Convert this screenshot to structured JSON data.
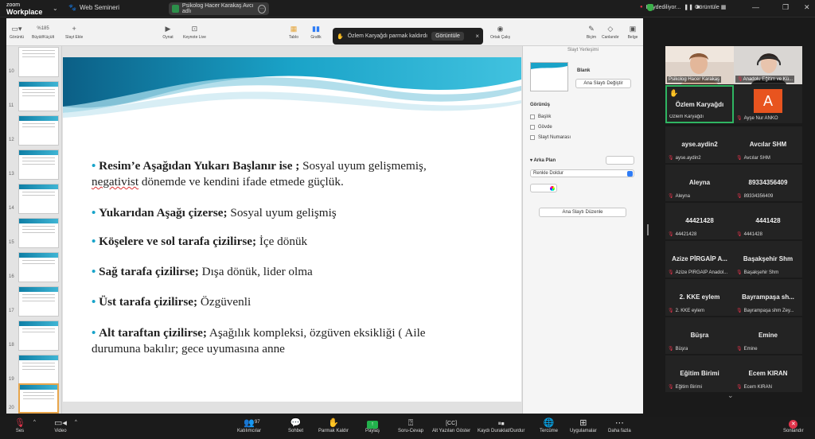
{
  "topbar": {
    "logo_line1": "zoom",
    "logo_line2": "Workplace",
    "webinar_title": "Web Semineri",
    "share_label": "Psikolog Hacer Karakaş Avcı adlı",
    "recording_status": "Kaydediliyor...",
    "view_label": "Görüntüle"
  },
  "keynote": {
    "toolbar": [
      {
        "label": "Görüntü",
        "icon": "sidebar-view-icon"
      },
      {
        "label": "Büyüt/Küçült",
        "icon": "zoom-icon",
        "value": "%185"
      },
      {
        "label": "Slayt Ekle",
        "icon": "plus-icon"
      },
      {
        "label": "Oynat",
        "icon": "play-icon"
      },
      {
        "label": "Keynote Live",
        "icon": "keynote-live-icon"
      },
      {
        "label": "Tablo",
        "icon": "table-icon"
      },
      {
        "label": "Grafik",
        "icon": "chart-icon"
      },
      {
        "label": "Ortak Çalış",
        "icon": "collaborate-icon"
      },
      {
        "label": "Biçim",
        "icon": "format-icon"
      },
      {
        "label": "Canlandır",
        "icon": "animate-icon"
      },
      {
        "label": "Belge",
        "icon": "document-icon"
      }
    ],
    "notification": {
      "text": "Özlem Karyağdı parmak kaldırdı",
      "button": "Görüntüle",
      "close": "×"
    },
    "thumbnails": [
      {
        "num": "10"
      },
      {
        "num": "11"
      },
      {
        "num": "12"
      },
      {
        "num": "13"
      },
      {
        "num": "14"
      },
      {
        "num": "15"
      },
      {
        "num": "16"
      },
      {
        "num": "17"
      },
      {
        "num": "18"
      },
      {
        "num": "19"
      },
      {
        "num": "20"
      }
    ],
    "slide": {
      "bullets": [
        {
          "bold": "Resim’e Aşağıdan Yukarı Başlanır ise ;",
          "rest": " Sosyal uyum gelişmemiş,",
          "line2a": "negativist",
          "line2b": " dönemde ve kendini ifade etmede güçlük."
        },
        {
          "bold": "Yukarıdan Aşağı çizerse;",
          "rest": " Sosyal uyum gelişmiş"
        },
        {
          "bold": "Köşelere ve sol tarafa çizilirse;",
          "rest": " İçe dönük"
        },
        {
          "bold": "Sağ tarafa çizilirse;",
          "rest": " Dışa dönük, lider olma"
        },
        {
          "bold": "Üst tarafa çizilirse;",
          "rest": " Özgüvenli"
        },
        {
          "bold": "Alt taraftan çizilirse;",
          "rest": " Aşağılık kompleksi, özgüven eksikliği ( Aile",
          "line2": "durumuna bakılır; gece uyumasına anne"
        }
      ]
    },
    "inspector": {
      "title": "Slayt Yerleşimi",
      "layout_name": "Blank",
      "change_master": "Ana Slaytı Değiştir",
      "appearance": "Görünüş",
      "options": [
        "Başlık",
        "Gövde",
        "Slayt Numarası"
      ],
      "background": "Arka Plan",
      "fill": "Renkle Doldur",
      "edit_master": "Ana Slaytı Düzenle"
    }
  },
  "participants": {
    "video": [
      {
        "name": "Psikolog Hacer Karakaş"
      },
      {
        "name": "Anadolu Eğitim ve Kü..."
      }
    ],
    "raised": {
      "name": "Özlem Karyağdı",
      "label": "Özlem Karyağdı"
    },
    "avatar": {
      "initial": "A",
      "label": "Ayşe Nur ANKO",
      "color": "#e8541f"
    },
    "tiles": [
      {
        "name": "ayse.aydin2",
        "label": "ayse.aydin2"
      },
      {
        "name": "Avcılar SHM",
        "label": "Avcılar SHM"
      },
      {
        "name": "Aleyna",
        "label": "Aleyna"
      },
      {
        "name": "89334356409",
        "label": "89334356409"
      },
      {
        "name": "44421428",
        "label": "44421428"
      },
      {
        "name": "4441428",
        "label": "4441428"
      },
      {
        "name": "Azize PİRGAİP A...",
        "label": "Azize PİRGAİP Anadol..."
      },
      {
        "name": "Başakşehir Shm",
        "label": "Başakşehir Shm"
      },
      {
        "name": "2. KKE eylem",
        "label": "2. KKE eylem"
      },
      {
        "name": "Bayrampaşa sh...",
        "label": "Bayrampaşa shm Zey..."
      },
      {
        "name": "Büşra",
        "label": "Büşra"
      },
      {
        "name": "Emine",
        "label": "Emine"
      },
      {
        "name": "Eğitim Birimi",
        "label": "Eğitim Birimi"
      },
      {
        "name": "Ecem KIRAN",
        "label": "Ecem KIRAN"
      }
    ]
  },
  "bottombar": [
    {
      "label": "Ses",
      "icon": "mic-muted-icon"
    },
    {
      "label": "Video",
      "icon": "video-icon"
    },
    {
      "label": "Katılımcılar",
      "icon": "participants-icon",
      "count": "97"
    },
    {
      "label": "Sohbet",
      "icon": "chat-icon"
    },
    {
      "label": "Parmak Kaldır",
      "icon": "raise-hand-icon"
    },
    {
      "label": "Paylaş",
      "icon": "share-icon"
    },
    {
      "label": "Soru-Cevap",
      "icon": "qa-icon"
    },
    {
      "label": "Alt Yazıları Göster",
      "icon": "captions-icon"
    },
    {
      "label": "Kaydı Duraklat/Durdur",
      "icon": "pause-record-icon"
    },
    {
      "label": "Tercüme",
      "icon": "globe-icon"
    },
    {
      "label": "Uygulamalar",
      "icon": "apps-icon"
    },
    {
      "label": "Daha fazla",
      "icon": "more-icon"
    },
    {
      "label": "Sonlandır",
      "icon": "end-icon"
    }
  ]
}
